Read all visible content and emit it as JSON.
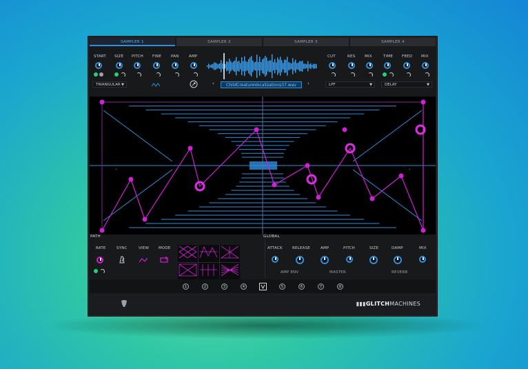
{
  "tabs": [
    {
      "label": "SAMPLER 1",
      "active": true
    },
    {
      "label": "SAMPLER 2",
      "active": false
    },
    {
      "label": "SAMPLER 3",
      "active": false
    },
    {
      "label": "SAMPLER 4",
      "active": false
    }
  ],
  "sampler": {
    "params": [
      "START",
      "SIZE",
      "PITCH",
      "FINE",
      "PAN",
      "AMP"
    ],
    "shape_select": "TRIANGULAR",
    "filename": "ChildCreatureVocalizations37.wav",
    "prev_arrow": "‹",
    "next_arrow": "›"
  },
  "filter": {
    "params": [
      "CUT",
      "RES",
      "MIX"
    ],
    "type_select": "LPF"
  },
  "delay": {
    "params": [
      "TIME",
      "FEED",
      "MIX"
    ],
    "type_select": "DELAY"
  },
  "viz": {
    "path_label": "PATH",
    "global_label": "GLOBAL"
  },
  "path_controls": {
    "labels": [
      "RATE",
      "SYNC",
      "VIEW",
      "MODE"
    ]
  },
  "global_controls": {
    "labels": [
      "ATTACK",
      "RELEASE",
      "AMP",
      "PITCH",
      "SIZE",
      "DAMP",
      "MIX"
    ],
    "groups": [
      "AMP ENV",
      "MASTER",
      "REVERB"
    ]
  },
  "numbers": [
    "1",
    "2",
    "3",
    "4",
    "5",
    "6",
    "7",
    "8"
  ],
  "brand": {
    "prefix": "GLITCH",
    "suffix": "MACHINES"
  },
  "colors": {
    "accent": "#2e8fe0",
    "magenta": "#d21fd8",
    "green": "#24d07a"
  }
}
